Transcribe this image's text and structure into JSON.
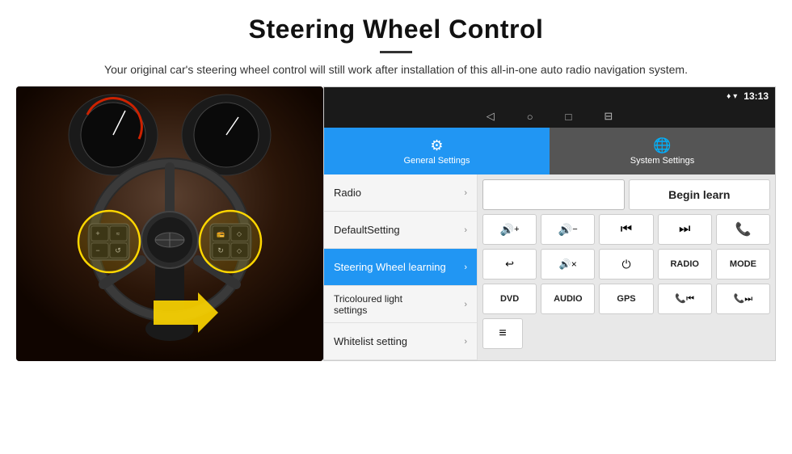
{
  "header": {
    "title": "Steering Wheel Control",
    "divider": true,
    "subtitle": "Your original car's steering wheel control will still work after installation of this all-in-one auto radio navigation system."
  },
  "android_ui": {
    "status_bar": {
      "time": "13:13",
      "icons": [
        "♦",
        "▾",
        "●"
      ]
    },
    "nav_bar": {
      "buttons": [
        "◁",
        "○",
        "□",
        "⊟"
      ]
    },
    "tabs": [
      {
        "id": "general",
        "label": "General Settings",
        "active": true,
        "icon": "⚙"
      },
      {
        "id": "system",
        "label": "System Settings",
        "active": false,
        "icon": "🌐"
      }
    ],
    "menu": [
      {
        "label": "Radio",
        "active": false
      },
      {
        "label": "DefaultSetting",
        "active": false
      },
      {
        "label": "Steering Wheel learning",
        "active": true
      },
      {
        "label": "Tricoloured light settings",
        "active": false
      },
      {
        "label": "Whitelist setting",
        "active": false
      }
    ],
    "controls": {
      "begin_learn": "Begin learn",
      "row2": [
        "🔊+",
        "🔊-",
        "⏮",
        "⏭",
        "📞"
      ],
      "row3": [
        "↩",
        "🔊×",
        "⏻",
        "RADIO",
        "MODE"
      ],
      "row4": [
        "DVD",
        "AUDIO",
        "GPS",
        "📞⏮",
        "📞⏭"
      ],
      "row5": [
        "≡"
      ]
    }
  }
}
